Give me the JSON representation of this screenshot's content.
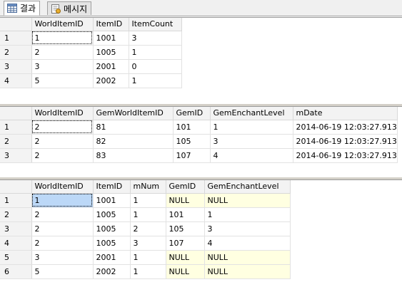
{
  "tabs": [
    {
      "label": "결과",
      "icon": "grid-icon",
      "active": true
    },
    {
      "label": "메시지",
      "icon": "message-icon",
      "active": false
    }
  ],
  "results": [
    {
      "columns": [
        "WorldItemID",
        "ItemID",
        "ItemCount"
      ],
      "rows": [
        [
          "1",
          "1",
          "1001",
          "3"
        ],
        [
          "2",
          "2",
          "1005",
          "1"
        ],
        [
          "3",
          "3",
          "2001",
          "0"
        ],
        [
          "4",
          "5",
          "2002",
          "1"
        ]
      ]
    },
    {
      "columns": [
        "WorldItemID",
        "GemWorldItemID",
        "GemID",
        "GemEnchantLevel",
        "mDate"
      ],
      "rows": [
        [
          "1",
          "2",
          "81",
          "101",
          "1",
          "2014-06-19 12:03:27.913"
        ],
        [
          "2",
          "2",
          "82",
          "105",
          "3",
          "2014-06-19 12:03:27.913"
        ],
        [
          "3",
          "2",
          "83",
          "107",
          "4",
          "2014-06-19 12:03:27.913"
        ]
      ]
    },
    {
      "columns": [
        "WorldItemID",
        "ItemID",
        "mNum",
        "GemID",
        "GemEnchantLevel"
      ],
      "rows": [
        [
          "1",
          "1",
          "1001",
          "1",
          "NULL",
          "NULL"
        ],
        [
          "2",
          "2",
          "1005",
          "1",
          "101",
          "1"
        ],
        [
          "3",
          "2",
          "1005",
          "2",
          "105",
          "3"
        ],
        [
          "4",
          "2",
          "1005",
          "3",
          "107",
          "4"
        ],
        [
          "5",
          "3",
          "2001",
          "1",
          "NULL",
          "NULL"
        ],
        [
          "6",
          "5",
          "2002",
          "1",
          "NULL",
          "NULL"
        ]
      ]
    }
  ],
  "colors": {
    "null_background": "#ffffe1",
    "selected_cell": "#bcd8f7",
    "header_background": "#f3f3f3"
  }
}
